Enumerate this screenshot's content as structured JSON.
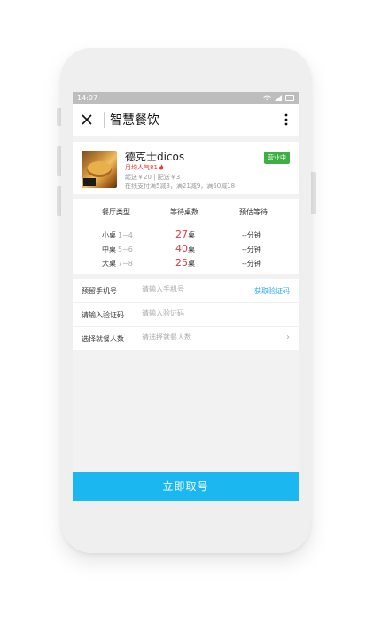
{
  "status_bar": {
    "time": "14:07"
  },
  "navbar": {
    "title": "智慧餐饮"
  },
  "shop": {
    "name": "德克士dicos",
    "popularity": "月均人气81",
    "price_info": "起送￥20 | 配送￥3",
    "promo": "在线支付满5减3，满21减9，满60减18",
    "status": "营业中"
  },
  "queue": {
    "headers": [
      "餐厅类型",
      "等待桌数",
      "预估等待"
    ],
    "rows": [
      {
        "type": "小桌",
        "range": "1~4",
        "count": "27",
        "unit": "桌",
        "estimate": "--分钟"
      },
      {
        "type": "中桌",
        "range": "5~6",
        "count": "40",
        "unit": "桌",
        "estimate": "--分钟"
      },
      {
        "type": "大桌",
        "range": "7~8",
        "count": "25",
        "unit": "桌",
        "estimate": "--分钟"
      }
    ]
  },
  "form": {
    "phone": {
      "label": "预留手机号",
      "placeholder": "请输入手机号",
      "action": "获取验证码"
    },
    "code": {
      "label": "请输入验证码",
      "placeholder": "请输入验证码"
    },
    "people": {
      "label": "选择就餐人数",
      "placeholder": "请选择就餐人数"
    }
  },
  "submit_label": "立即取号",
  "colors": {
    "accent": "#1ab7f0",
    "open_badge": "#3cb043",
    "highlight": "#e53935",
    "link": "#29a8e8"
  },
  "icons": [
    "wifi-icon",
    "signal-icon",
    "battery-icon",
    "close-icon",
    "more-vertical-icon",
    "flame-icon",
    "chevron-right-icon"
  ]
}
